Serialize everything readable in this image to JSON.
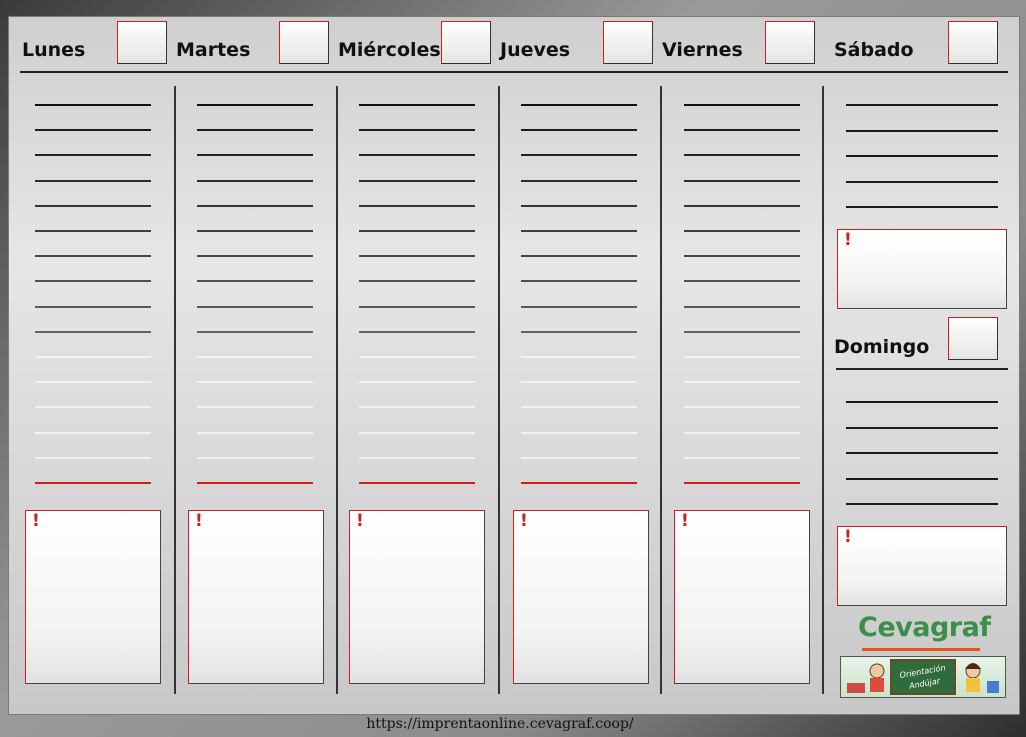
{
  "days": [
    {
      "key": "lunes",
      "label": "Lunes"
    },
    {
      "key": "martes",
      "label": "Martes"
    },
    {
      "key": "miercoles",
      "label": "Miércoles"
    },
    {
      "key": "jueves",
      "label": "Jueves"
    },
    {
      "key": "viernes",
      "label": "Viernes"
    },
    {
      "key": "sabado",
      "label": "Sábado"
    },
    {
      "key": "domingo",
      "label": "Domingo"
    }
  ],
  "note_mark": "!",
  "brand": {
    "name": "Cevagraf",
    "banner_text": "Orientación Andújar"
  },
  "footer": {
    "url": "https://imprentaonline.cevagraf.coop/"
  },
  "colors": {
    "accent_red": "#d21d1d",
    "brand_green": "#3c8f4a",
    "brand_orange": "#e0561e"
  }
}
